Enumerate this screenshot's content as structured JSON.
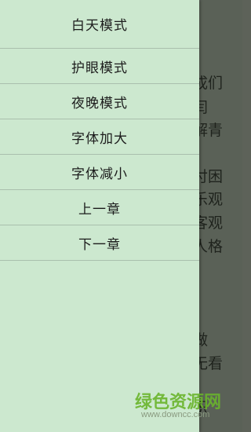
{
  "menu": {
    "items": [
      {
        "label": "白天模式"
      },
      {
        "label": "护眼模式"
      },
      {
        "label": "夜晚模式"
      },
      {
        "label": "字体加大"
      },
      {
        "label": "字体减小"
      },
      {
        "label": "上一章"
      },
      {
        "label": "下一章"
      }
    ]
  },
  "reader": {
    "lines": [
      "成们",
      "闫",
      "解青",
      "付困",
      "乐观",
      "客观",
      "人格",
      "做",
      "无看",
      "识"
    ]
  },
  "watermark": {
    "brand": "绿色资源网",
    "url": "www.downcc.com"
  },
  "colors": {
    "menu_bg": "#cce8cf",
    "reader_bg": "#5a6157",
    "divider": "#a9bfad",
    "watermark": "#6ab52c"
  }
}
